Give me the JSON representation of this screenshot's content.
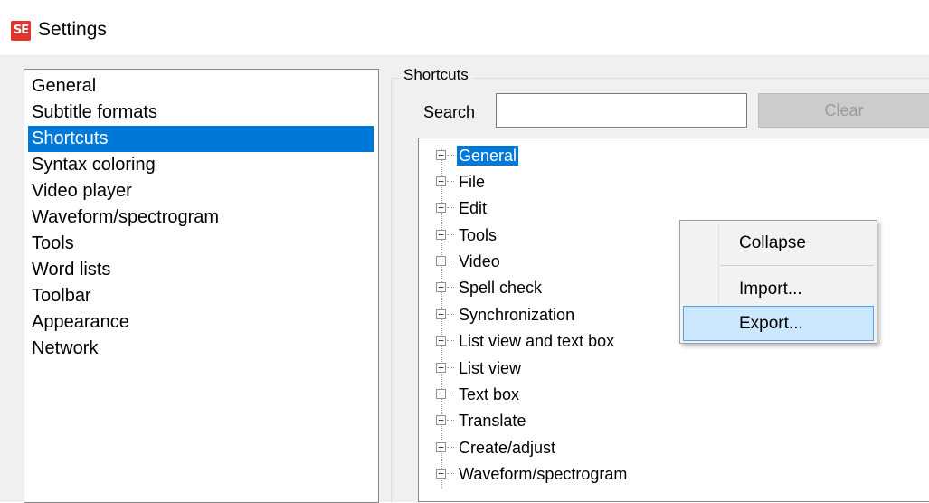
{
  "window": {
    "title": "Settings",
    "icon": "subtitle-edit-app-icon",
    "icon_text": "SE",
    "icon_color": "#e0342c"
  },
  "categories": [
    {
      "label": "General",
      "selected": false
    },
    {
      "label": "Subtitle formats",
      "selected": false
    },
    {
      "label": "Shortcuts",
      "selected": true
    },
    {
      "label": "Syntax coloring",
      "selected": false
    },
    {
      "label": "Video player",
      "selected": false
    },
    {
      "label": "Waveform/spectrogram",
      "selected": false
    },
    {
      "label": "Tools",
      "selected": false
    },
    {
      "label": "Word lists",
      "selected": false
    },
    {
      "label": "Toolbar",
      "selected": false
    },
    {
      "label": "Appearance",
      "selected": false
    },
    {
      "label": "Network",
      "selected": false
    }
  ],
  "shortcuts": {
    "group_title": "Shortcuts",
    "search_label": "Search",
    "search_value": "",
    "clear_label": "Clear",
    "tree": [
      {
        "label": "General",
        "selected": true
      },
      {
        "label": "File",
        "selected": false
      },
      {
        "label": "Edit",
        "selected": false
      },
      {
        "label": "Tools",
        "selected": false
      },
      {
        "label": "Video",
        "selected": false
      },
      {
        "label": "Spell check",
        "selected": false
      },
      {
        "label": "Synchronization",
        "selected": false
      },
      {
        "label": "List view and text box",
        "selected": false
      },
      {
        "label": "List view",
        "selected": false
      },
      {
        "label": "Text box",
        "selected": false
      },
      {
        "label": "Translate",
        "selected": false
      },
      {
        "label": "Create/adjust",
        "selected": false
      },
      {
        "label": "Waveform/spectrogram",
        "selected": false
      }
    ],
    "expander_glyph": "+"
  },
  "context_menu": {
    "items": [
      {
        "label": "Collapse",
        "highlighted": false
      },
      {
        "label": "Import...",
        "highlighted": false
      },
      {
        "label": "Export...",
        "highlighted": true
      }
    ]
  },
  "colors": {
    "selection": "#0078d7",
    "menu_highlight": "#cce8ff",
    "menu_highlight_border": "#56a1e3",
    "disabled_button": "#cccccc"
  }
}
